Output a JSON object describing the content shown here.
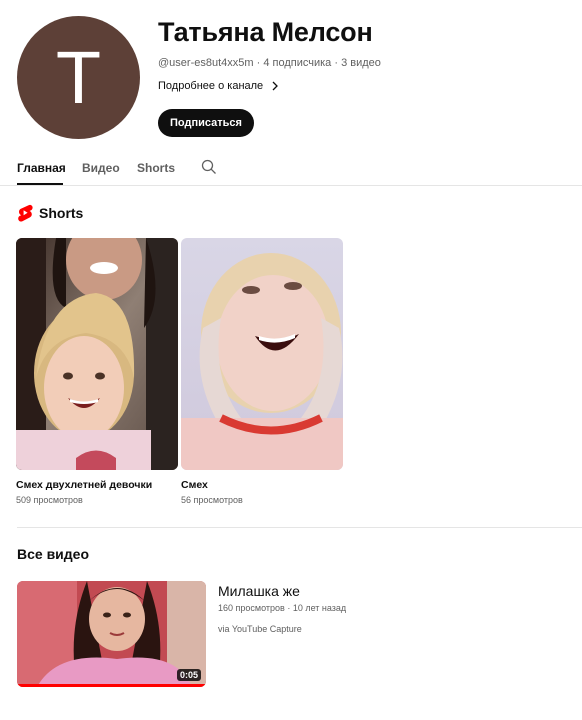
{
  "channel": {
    "avatar_letter": "Т",
    "avatar_color": "#5d4037",
    "name": "Татьяна Мелсон",
    "handle": "@user-es8ut4xx5m",
    "subscribers": "4 подписчика",
    "videos": "3 видео",
    "about": "Подробнее о канале",
    "subscribe": "Подписаться"
  },
  "tabs": [
    {
      "label": "Главная",
      "active": true
    },
    {
      "label": "Видео",
      "active": false
    },
    {
      "label": "Shorts",
      "active": false
    }
  ],
  "shorts_section": {
    "title": "Shorts",
    "items": [
      {
        "title": "Смех двухлетней девочки",
        "views": "509 просмотров"
      },
      {
        "title": "Смех",
        "views": "56 просмотров"
      }
    ]
  },
  "videos_section": {
    "title": "Все видео",
    "items": [
      {
        "title": "Милашка же",
        "views": "160 просмотров",
        "age": "10 лет назад",
        "description": "via YouTube Capture",
        "duration": "0:05",
        "watched_fraction": 1.0
      }
    ]
  },
  "colors": {
    "accent": "#ff0000",
    "text": "#0f0f0f",
    "secondary": "#606060"
  }
}
